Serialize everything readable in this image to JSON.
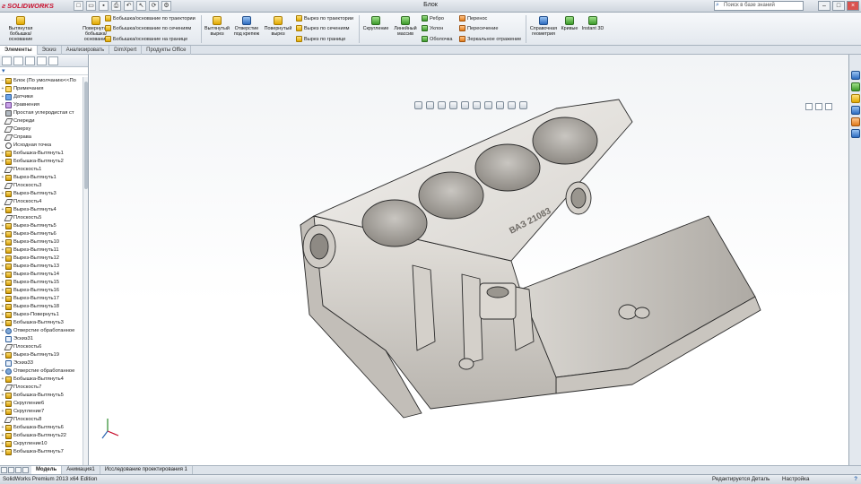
{
  "app": {
    "logo": "SOLIDWORKS",
    "doc_title": "Блок"
  },
  "search": {
    "placeholder": "Поиск в базе знаний"
  },
  "ribbon": {
    "extrude_boss": "Вытянутая бобышка/основание",
    "revolve_boss": "Повернутая бобышка/основание",
    "swept_boss": "Бобышка/основание по траектории",
    "loft_boss": "Бобышка/основание по сечениям",
    "boundary_boss": "Бобышка/основание на границе",
    "extruded_cut": "Вытянутый вырез",
    "hole_wizard": "Отверстие под крепеж",
    "revolved_cut": "Повернутый вырез",
    "swept_cut": "Вырез по траектории",
    "lofted_cut": "Вырез по сечениям",
    "boundary_cut": "Вырез по границе",
    "fillet": "Скругление",
    "linear_pattern": "Линейный массив",
    "rib": "Ребро",
    "draft": "Уклон",
    "shell": "Оболочка",
    "wrap": "Перенос",
    "intersect": "Пересечение",
    "mirror": "Зеркальное отражение",
    "ref_geometry": "Справочная геометрия",
    "curves": "Кривые",
    "instant3d": "Instant 3D"
  },
  "tabs": [
    "Элементы",
    "Эскиз",
    "Анализировать",
    "DimXpert",
    "Продукты Office"
  ],
  "tree": {
    "root": "Блок  (По умолчанию<<По",
    "items": [
      {
        "label": "Примечания",
        "type": "ann"
      },
      {
        "label": "Датчики",
        "type": "sensor"
      },
      {
        "label": "Уравнения",
        "type": "eq"
      },
      {
        "label": "Простая углеродистая ст",
        "type": "mat"
      },
      {
        "label": "Спереди",
        "type": "plane"
      },
      {
        "label": "Сверху",
        "type": "plane"
      },
      {
        "label": "Справа",
        "type": "plane"
      },
      {
        "label": "Исходная точка",
        "type": "origin"
      },
      {
        "label": "Бобышка-Вытянуть1",
        "type": "feat"
      },
      {
        "label": "Бобышка-Вытянуть2",
        "type": "feat"
      },
      {
        "label": "Плоскость1",
        "type": "plane"
      },
      {
        "label": "Вырез-Вытянуть1",
        "type": "feat"
      },
      {
        "label": "Плоскость3",
        "type": "plane"
      },
      {
        "label": "Вырез-Вытянуть3",
        "type": "feat"
      },
      {
        "label": "Плоскость4",
        "type": "plane"
      },
      {
        "label": "Вырез-Вытянуть4",
        "type": "feat"
      },
      {
        "label": "Плоскость5",
        "type": "plane"
      },
      {
        "label": "Вырез-Вытянуть5",
        "type": "feat"
      },
      {
        "label": "Вырез-Вытянуть6",
        "type": "feat"
      },
      {
        "label": "Вырез-Вытянуть10",
        "type": "feat"
      },
      {
        "label": "Вырез-Вытянуть11",
        "type": "feat"
      },
      {
        "label": "Вырез-Вытянуть12",
        "type": "feat"
      },
      {
        "label": "Вырез-Вытянуть13",
        "type": "feat"
      },
      {
        "label": "Вырез-Вытянуть14",
        "type": "feat"
      },
      {
        "label": "Вырез-Вытянуть15",
        "type": "feat"
      },
      {
        "label": "Вырез-Вытянуть16",
        "type": "feat"
      },
      {
        "label": "Вырез-Вытянуть17",
        "type": "feat"
      },
      {
        "label": "Вырез-Вытянуть18",
        "type": "feat"
      },
      {
        "label": "Вырез-Повернуть1",
        "type": "feat"
      },
      {
        "label": "Бобышка-Вытянуть3",
        "type": "feat"
      },
      {
        "label": "Отверстие обработанное",
        "type": "hole"
      },
      {
        "label": "Эскиз31",
        "type": "sketch"
      },
      {
        "label": "Плоскость6",
        "type": "plane"
      },
      {
        "label": "Вырез-Вытянуть19",
        "type": "feat"
      },
      {
        "label": "Эскиз33",
        "type": "sketch"
      },
      {
        "label": "Отверстие обработанное",
        "type": "hole"
      },
      {
        "label": "Бобышка-Вытянуть4",
        "type": "feat"
      },
      {
        "label": "Плоскость7",
        "type": "plane"
      },
      {
        "label": "Бобышка-Вытянуть5",
        "type": "feat"
      },
      {
        "label": "Скругление6",
        "type": "feat"
      },
      {
        "label": "Скругление7",
        "type": "feat"
      },
      {
        "label": "Плоскость8",
        "type": "plane"
      },
      {
        "label": "Бобышка-Вытянуть6",
        "type": "feat"
      },
      {
        "label": "Бобышка-Вытянуть22",
        "type": "feat"
      },
      {
        "label": "Скругление10",
        "type": "feat"
      },
      {
        "label": "Бобышка-Вытянуть7",
        "type": "feat"
      }
    ]
  },
  "bottom_tabs": [
    "Модель",
    "Анимация1",
    "Исследование проектирования 1"
  ],
  "status": {
    "left": "SolidWorks Premium 2013 x64 Edition",
    "editing": "Редактируется Деталь",
    "customize": "Настройка"
  },
  "model": {
    "stamp": "ВАЗ 21083"
  }
}
